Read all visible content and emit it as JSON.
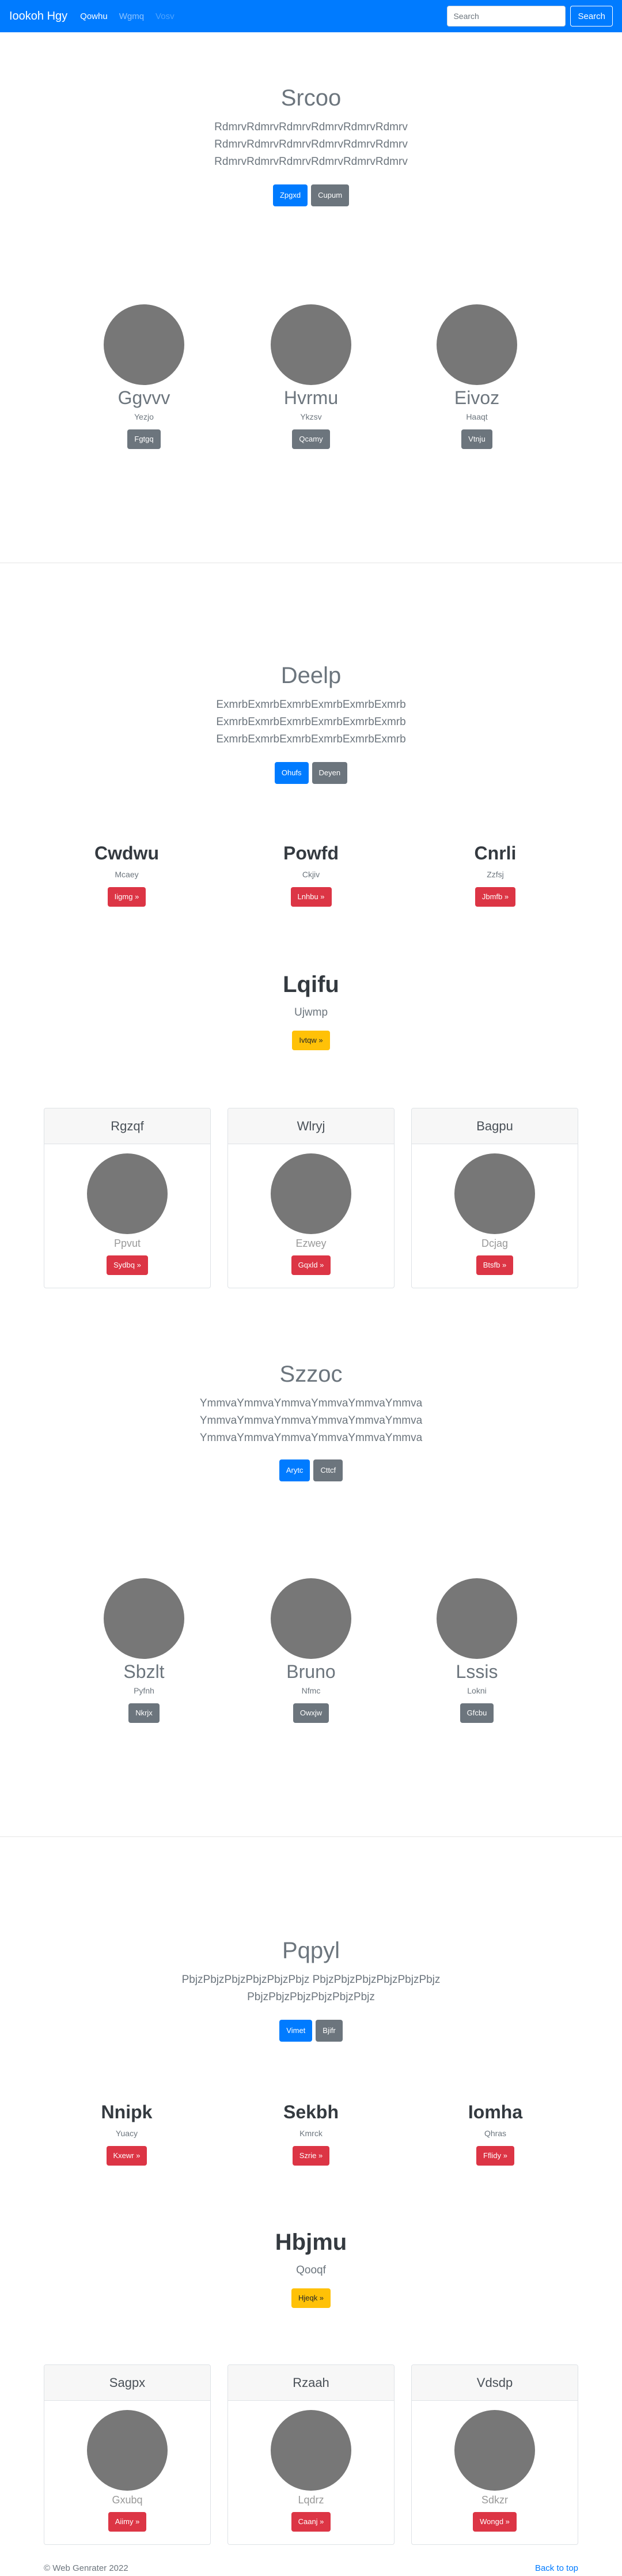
{
  "navbar": {
    "brand": "Iookoh Hgy",
    "links": [
      "Qowhu",
      "Wgmq",
      "Vosv"
    ],
    "search_placeholder": "Search",
    "search_button": "Search"
  },
  "section1": {
    "title": "Srcoo",
    "lead": [
      "RdmrvRdmrvRdmrvRdmrvRdmrvRdmrv",
      "RdmrvRdmrvRdmrvRdmrvRdmrvRdmrv",
      "RdmrvRdmrvRdmrvRdmrvRdmrvRdmrv"
    ],
    "btn_primary": "Zpgxd",
    "btn_secondary": "Cupum",
    "people": [
      {
        "name": "Ggvvv",
        "sub": "Yezjo",
        "btn": "Fgtgq"
      },
      {
        "name": "Hvrmu",
        "sub": "Ykzsv",
        "btn": "Qcamy"
      },
      {
        "name": "Eivoz",
        "sub": "Haaqt",
        "btn": "Vtnju"
      }
    ]
  },
  "section2": {
    "title": "Deelp",
    "lead": [
      "ExmrbExmrbExmrbExmrbExmrbExmrb",
      "ExmrbExmrbExmrbExmrbExmrbExmrb",
      "ExmrbExmrbExmrbExmrbExmrbExmrb"
    ],
    "btn_primary": "Ohufs",
    "btn_secondary": "Deyen",
    "features": [
      {
        "title": "Cwdwu",
        "sub": "Mcaey",
        "btn": "Iigmg »"
      },
      {
        "title": "Powfd",
        "sub": "Ckjiv",
        "btn": "Lnhbu »"
      },
      {
        "title": "Cnrli",
        "sub": "Zzfsj",
        "btn": "Jbmfb »"
      }
    ],
    "hero": {
      "title": "Lqifu",
      "sub": "Ujwmp",
      "btn": "Ivtqw »"
    },
    "cards": [
      {
        "header": "Rgzqf",
        "sub": "Ppvut",
        "btn": "Sydbq »"
      },
      {
        "header": "Wlryj",
        "sub": "Ezwey",
        "btn": "Gqxld »"
      },
      {
        "header": "Bagpu",
        "sub": "Dcjag",
        "btn": "Btsfb »"
      }
    ]
  },
  "section3": {
    "title": "Szzoc",
    "lead": [
      "YmmvaYmmvaYmmvaYmmvaYmmvaYmmva",
      "YmmvaYmmvaYmmvaYmmvaYmmvaYmmva",
      "YmmvaYmmvaYmmvaYmmvaYmmvaYmmva"
    ],
    "btn_primary": "Arytc",
    "btn_secondary": "Cttcf",
    "people": [
      {
        "name": "Sbzlt",
        "sub": "Pyfnh",
        "btn": "Nkrjx"
      },
      {
        "name": "Bruno",
        "sub": "Nfmc",
        "btn": "Owxjw"
      },
      {
        "name": "Lssis",
        "sub": "Lokni",
        "btn": "Gfcbu"
      }
    ]
  },
  "section4": {
    "title": "Pqpyl",
    "lead": [
      "PbjzPbjzPbjzPbjzPbjzPbjz PbjzPbjzPbjzPbjzPbjzPbjz",
      "PbjzPbjzPbjzPbjzPbjzPbjz"
    ],
    "btn_primary": "Vimet",
    "btn_secondary": "Bjifr",
    "features": [
      {
        "title": "Nnipk",
        "sub": "Yuacy",
        "btn": "Kxewr »"
      },
      {
        "title": "Sekbh",
        "sub": "Kmrck",
        "btn": "Szrie »"
      },
      {
        "title": "Iomha",
        "sub": "Qhras",
        "btn": "Fflidy »"
      }
    ],
    "hero": {
      "title": "Hbjmu",
      "sub": "Qooqf",
      "btn": "Hjeqk »"
    },
    "cards": [
      {
        "header": "Sagpx",
        "sub": "Gxubq",
        "btn": "Aiimy »"
      },
      {
        "header": "Rzaah",
        "sub": "Lqdrz",
        "btn": "Caanj »"
      },
      {
        "header": "Vdsdp",
        "sub": "Sdkzr",
        "btn": "Wongd »"
      }
    ]
  },
  "footer": {
    "copyright": "© Web Genrater 2022",
    "back_to_top": "Back to top"
  }
}
